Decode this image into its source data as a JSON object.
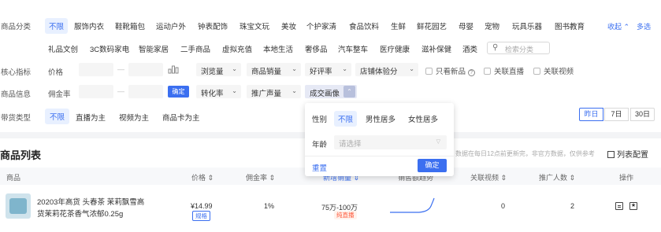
{
  "filters": {
    "category_label": "商品分类",
    "categories_row1": [
      "不限",
      "服饰内衣",
      "鞋靴箱包",
      "运动户外",
      "钟表配饰",
      "珠宝文玩",
      "美妆",
      "个护家清",
      "食品饮料",
      "生鲜",
      "鲜花园艺",
      "母婴",
      "宠物",
      "玩具乐器",
      "图书教育"
    ],
    "categories_row2": [
      "礼品文创",
      "3C数码家电",
      "智能家居",
      "二手商品",
      "虚拟充值",
      "本地生活",
      "奢侈品",
      "汽车整车",
      "医疗健康",
      "滋补保健",
      "酒类"
    ],
    "search_placeholder": "检索分类",
    "collapse_label": "收起",
    "multi_select_label": "多选",
    "core_metric_label": "核心指标",
    "price_label": "价格",
    "dash": "—",
    "dropdowns_row1": [
      "浏览量",
      "商品销量",
      "好评率",
      "店铺体验分"
    ],
    "checkboxes": [
      "只看新品",
      "关联直播",
      "关联视频"
    ],
    "product_info_label": "商品信息",
    "commission_label": "佣金率",
    "confirm_label": "确定",
    "dropdowns_row2": [
      "转化率",
      "推广声量",
      "成交画像"
    ],
    "carry_type_label": "带货类型",
    "carry_types": [
      "不限",
      "直播为主",
      "视频为主",
      "商品卡为主"
    ],
    "date_ranges": [
      "昨日",
      "7日",
      "30日"
    ]
  },
  "popup": {
    "gender_label": "性别",
    "genders": [
      "不限",
      "男性居多",
      "女性居多"
    ],
    "age_label": "年龄",
    "age_placeholder": "请选择",
    "reset_label": "重置",
    "confirm_label": "确定"
  },
  "list": {
    "title": "商品列表",
    "note": "数据在每日12点前更新完，非官方数据，仅供参考",
    "config_label": "列表配置",
    "columns": [
      "商品",
      "价格",
      "佣金率",
      "销售额趋势",
      "关联视频",
      "推广人数",
      "操作"
    ],
    "rows": [
      {
        "name_line1": "20203年高货 头春茶 茉莉飘雪高",
        "name_line2": "货茉莉花茶香气浓郁0.25g",
        "price": "¥14.99",
        "price_tag": "规格",
        "commission": "1%",
        "sales": "75万-100万",
        "sales_tag": "纯直播",
        "videos": "0",
        "promoters": "2"
      }
    ]
  },
  "colors": {
    "accent": "#3b6ff0",
    "accent_light": "#e8f0ff",
    "red": "#ff5a3c"
  }
}
